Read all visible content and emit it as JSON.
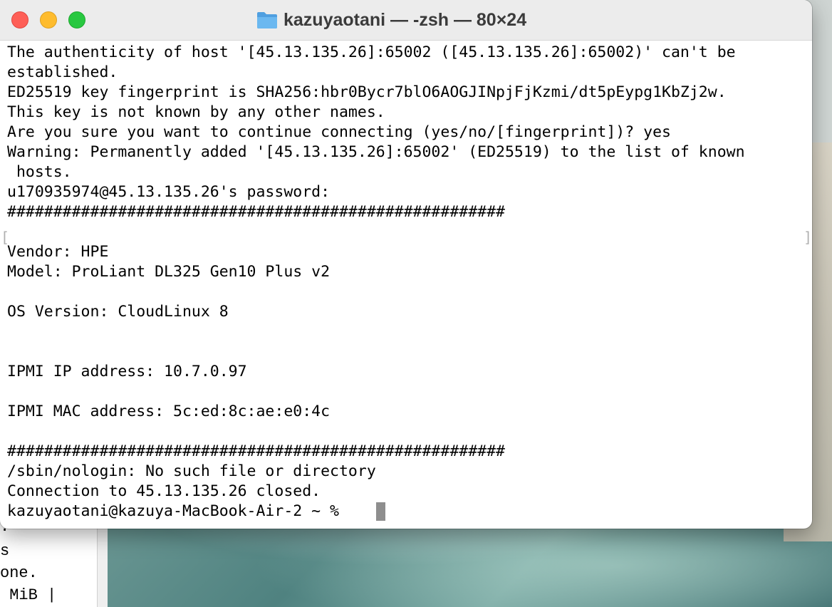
{
  "window": {
    "title": "kazuyaotani — -zsh — 80×24"
  },
  "terminal": {
    "lines": [
      "The authenticity of host '[45.13.135.26]:65002 ([45.13.135.26]:65002)' can't be",
      "established.",
      "ED25519 key fingerprint is SHA256:hbr0Bycr7blO6AOGJINpjFjKzmi/dt5pEypg1KbZj2w.",
      "This key is not known by any other names.",
      "Are you sure you want to continue connecting (yes/no/[fingerprint])? yes",
      "Warning: Permanently added '[45.13.135.26]:65002' (ED25519) to the list of known",
      " hosts.",
      "u170935974@45.13.135.26's password:",
      "######################################################",
      "",
      "Vendor: HPE",
      "Model: ProLiant DL325 Gen10 Plus v2",
      "",
      "OS Version: CloudLinux 8",
      "",
      "",
      "IPMI IP address: 10.7.0.97",
      "",
      "IPMI MAC address: 5c:ed:8c:ae:e0:4c",
      "",
      "######################################################",
      "/sbin/nologin: No such file or directory",
      "Connection to 45.13.135.26 closed.",
      "kazuyaotani@kazuya-MacBook-Air-2 ~ % "
    ]
  },
  "background_window": {
    "lines": [
      ".",
      "s",
      "one.",
      " MiB |"
    ]
  },
  "colors": {
    "close": "#fe5f57",
    "minimize": "#febc2e",
    "maximize": "#28c840",
    "folder": "#5aa9e6"
  },
  "icons": [
    "close-icon",
    "minimize-icon",
    "maximize-icon",
    "folder-icon"
  ]
}
